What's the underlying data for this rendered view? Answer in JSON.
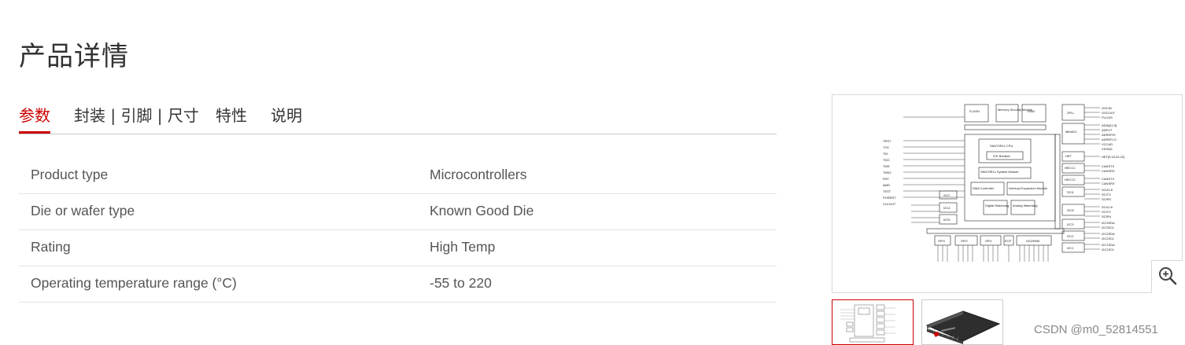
{
  "page": {
    "title": "产品详情"
  },
  "tabs": [
    {
      "label": "参数",
      "active": true
    },
    {
      "label": "封装 | 引脚 | 尺寸",
      "active": false
    },
    {
      "label": "特性",
      "active": false
    },
    {
      "label": "说明",
      "active": false
    }
  ],
  "parameters": [
    {
      "label": "Product type",
      "value": "Microcontrollers"
    },
    {
      "label": "Die or wafer type",
      "value": "Known Good Die"
    },
    {
      "label": "Rating",
      "value": "High Temp"
    },
    {
      "label": "Operating temperature range (°C)",
      "value": "-55 to 220"
    }
  ],
  "diagram": {
    "blocks": {
      "flash": "FLASH",
      "memory_security": "Memory Security Module",
      "ram": "RAM",
      "zpll": "ZPLL",
      "cpu": "SM470R1x CPU",
      "ice": "ICE Breaker",
      "system_module": "SM470R1x System Module",
      "dma": "DMA Controller",
      "interrupt": "Interrupt Expansion Module",
      "digital_watchdog": "Digital Watchdog",
      "analog_watchdog": "Analog Watchdog",
      "adc": "MibADC",
      "het": "HET",
      "hecc1": "HECC1",
      "hecc2": "HECC2",
      "sci1": "SCI1",
      "sci2": "SCI2",
      "i2c3": "I2C3",
      "i2c2": "I2C2",
      "i2c1": "I2C1",
      "scc": "SCC",
      "i2c4": "I2C4",
      "i2c5": "I2C5",
      "spi3": "SPI3",
      "spi2": "SPI2",
      "spi1": "SPI1",
      "ecp": "ECP",
      "gio": "GIO/EBM"
    },
    "pins_left": [
      "TRST",
      "TCK",
      "TDI",
      "TDO",
      "TMS",
      "TMS2",
      "RST",
      "AWD",
      "TEST",
      "PORRST",
      "CLKOUT"
    ],
    "pins_right": [
      "OSCIN",
      "OSCOUT",
      "PLLDIS",
      "ADIN[11:0]",
      "ADEVT",
      "ADREFHI",
      "ADREFLO",
      "VCCAD",
      "VSSAD",
      "HET[0:18,20,22]",
      "CANSTX",
      "CANSRX",
      "CANSTX",
      "CANSRX",
      "SCICLK",
      "SCITX",
      "SCIRX",
      "SCICLK",
      "SCITX",
      "SCIRX",
      "I2C3SDA",
      "I2C3SCL",
      "I2C2SDA",
      "I2C2SCL",
      "I2C1SDA",
      "I2C1SCL"
    ],
    "zoom_icon": "zoom-in-icon"
  },
  "thumbnails": [
    {
      "kind": "block-diagram",
      "active": true
    },
    {
      "kind": "chip-package-photo",
      "active": false
    }
  ],
  "watermark": "CSDN @m0_52814551",
  "colors": {
    "accent": "#cc0000",
    "text": "#333333",
    "muted": "#555555",
    "border": "#e3e3e3"
  }
}
